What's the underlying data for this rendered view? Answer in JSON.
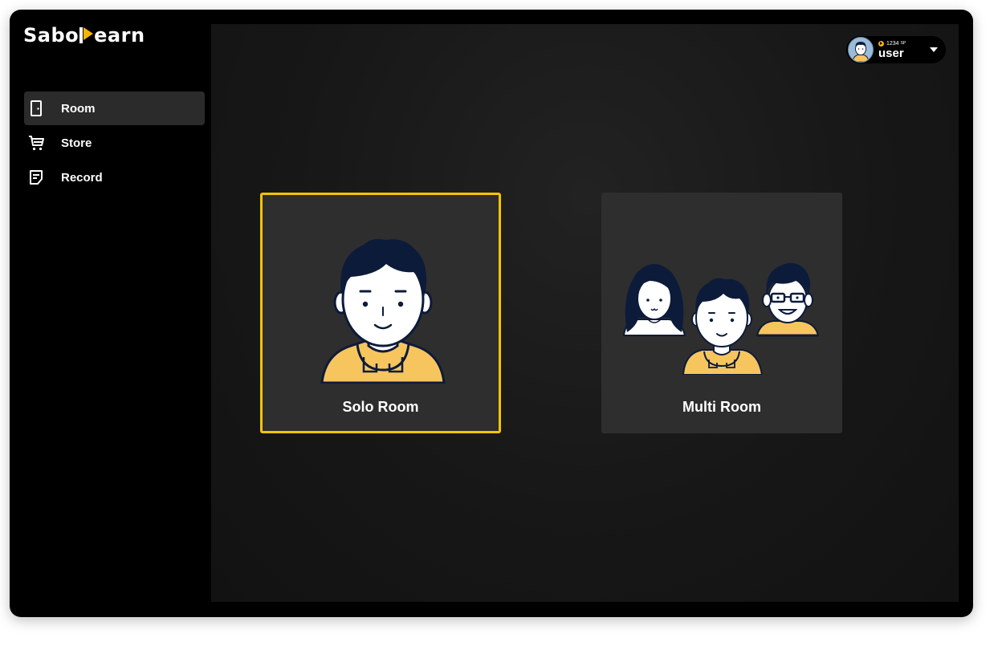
{
  "app": {
    "logo": {
      "before": "Sabo",
      "after": "earn"
    },
    "colors": {
      "accent": "#f6c400",
      "sidebar_bg": "#000000",
      "card_bg": "#2e2e2e",
      "active_nav_bg": "#2b2b2b"
    }
  },
  "sidebar": {
    "items": [
      {
        "label": "Room",
        "icon": "door-icon",
        "active": true
      },
      {
        "label": "Store",
        "icon": "cart-icon",
        "active": false
      },
      {
        "label": "Record",
        "icon": "note-icon",
        "active": false
      }
    ]
  },
  "header": {
    "user": {
      "points": "1234",
      "points_unit": "SP",
      "name": "user",
      "avatar_icon": "user-avatar-icon",
      "dropdown_icon": "caret-down-icon"
    }
  },
  "rooms": [
    {
      "label": "Solo Room",
      "selected": true,
      "icon": "solo-person-illustration"
    },
    {
      "label": "Multi Room",
      "selected": false,
      "icon": "group-people-illustration"
    }
  ]
}
